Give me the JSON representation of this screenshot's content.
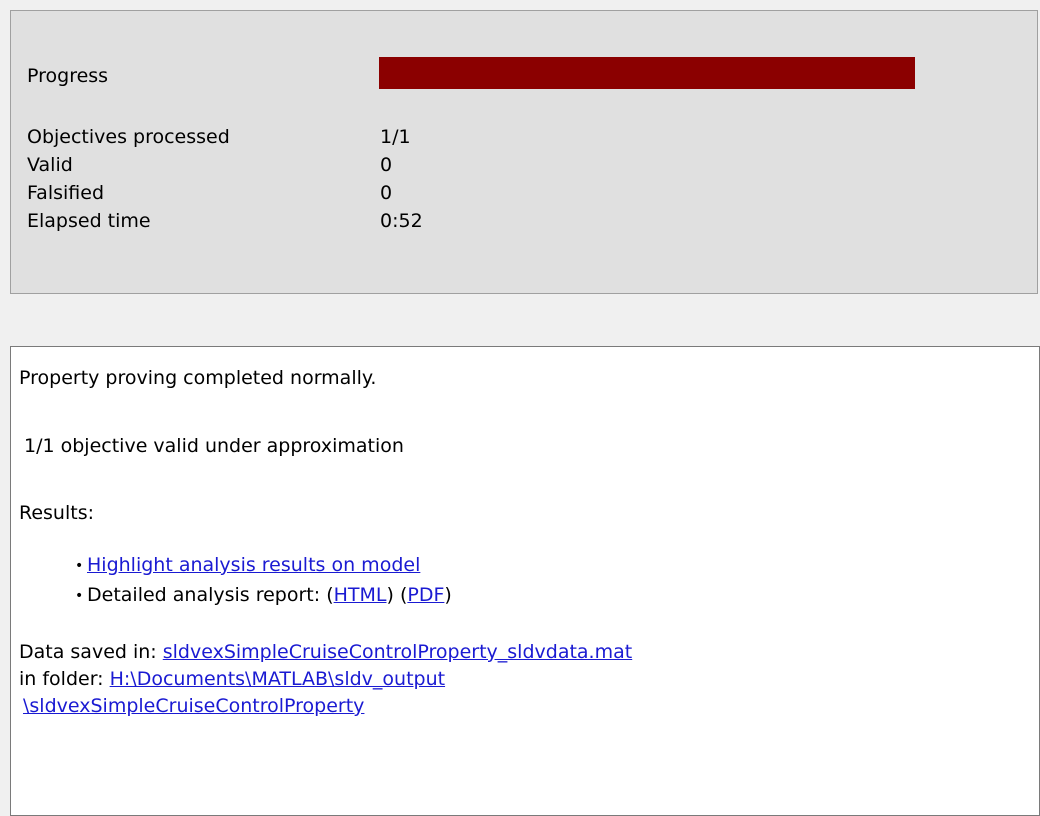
{
  "progress": {
    "label": "Progress",
    "fraction": 1.0,
    "color": "#8b0000"
  },
  "stats": [
    {
      "label": "Objectives processed",
      "value": "1/1"
    },
    {
      "label": "Valid",
      "value": "0"
    },
    {
      "label": "Falsified",
      "value": "0"
    },
    {
      "label": "Elapsed time",
      "value": "0:52"
    }
  ],
  "results": {
    "status_message": "Property proving completed normally.",
    "objective_summary": "1/1 objective valid under approximation",
    "results_heading": "Results:",
    "bullet_glyph": "•",
    "highlight_link": "Highlight analysis results on model",
    "report_prefix": "Detailed analysis report: (",
    "html_link": "HTML",
    "report_middle": ") (",
    "pdf_link": "PDF",
    "report_suffix": ")",
    "data_saved_prefix": "Data saved in: ",
    "data_file_link": "sldvexSimpleCruiseControlProperty_sldvdata.mat",
    "folder_prefix": "in folder: ",
    "folder_link_part1": "H:\\Documents\\MATLAB\\sldv_output",
    "folder_link_part2": "\\sldvexSimpleCruiseControlProperty"
  }
}
